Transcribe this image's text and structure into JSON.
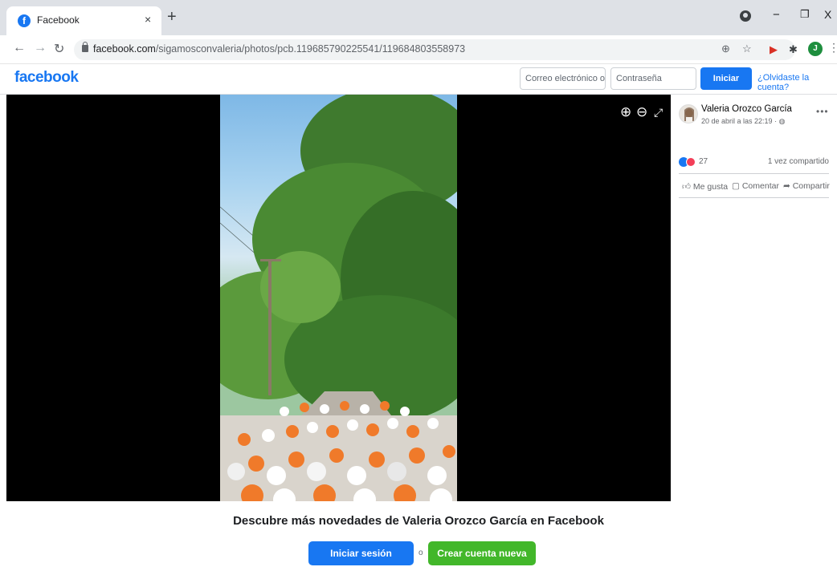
{
  "browser": {
    "tab_title": "Facebook",
    "tab_favicon": "f",
    "tab_close": "×",
    "new_tab": "+",
    "window_controls": {
      "minimize": "−",
      "restore": "❐",
      "close": "X"
    },
    "url_host": "facebook.com",
    "url_path": "/sigamosconvaleria/photos/pcb.119685790225541/119684803558973",
    "profile_initial": "J",
    "icons": [
      "back-icon",
      "forward-icon",
      "reload-icon",
      "lock-icon",
      "zoom-icon",
      "star-icon",
      "extension-icon",
      "puzzle-icon"
    ]
  },
  "fb_header": {
    "logo": "facebook",
    "email_placeholder": "Correo electrónico o teléfono",
    "password_placeholder": "Contraseña",
    "login_label": "Iniciar sesión",
    "forgot_label": "¿Olvidaste la cuenta?"
  },
  "viewer": {
    "zoom_in": "⊕",
    "zoom_out": "⊖",
    "fullscreen": "⤢"
  },
  "post": {
    "author": "Valeria Orozco García",
    "time": "20 de abril a las 22:19 · ",
    "privacy_icon": "globe-icon",
    "more": "•••",
    "reaction_count": "27",
    "shares": "1 vez compartido",
    "actions": {
      "like": "Me gusta",
      "comment": "Comentar",
      "share": "Compartir"
    }
  },
  "cta": {
    "title": "Descubre más novedades de Valeria Orozco García en Facebook",
    "login_label": "Iniciar sesión",
    "or_label": "o",
    "create_label": "Crear cuenta nueva"
  },
  "colors": {
    "fb_blue": "#1877f2",
    "create_green": "#42b72a",
    "viewer_bg": "#000000"
  }
}
